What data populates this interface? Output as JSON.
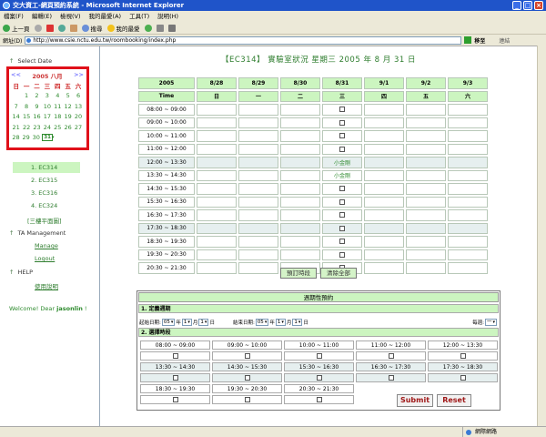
{
  "window": {
    "title": "交大資工-網頁預約系統 - Microsoft Internet Explorer"
  },
  "menu": [
    "檔案(F)",
    "編輯(E)",
    "檢視(V)",
    "我的最愛(A)",
    "工具(T)",
    "說明(H)"
  ],
  "toolbar": {
    "back": "上一頁",
    "search": "搜尋",
    "favorites": "我的最愛"
  },
  "address": {
    "label": "網址(D)",
    "url": "http://www.csie.nctu.edu.tw/roombooking/index.php",
    "go": "移至",
    "links": "連結"
  },
  "sidebar": {
    "select_date": "Select Date",
    "calendar": {
      "month_label": "2005 八月",
      "prev": "<<",
      "next": ">>",
      "weekdays": [
        "日",
        "一",
        "二",
        "三",
        "四",
        "五",
        "六"
      ],
      "weeks": [
        [
          "",
          "1",
          "2",
          "3",
          "4",
          "5",
          "6"
        ],
        [
          "7",
          "8",
          "9",
          "10",
          "11",
          "12",
          "13"
        ],
        [
          "14",
          "15",
          "16",
          "17",
          "18",
          "19",
          "20"
        ],
        [
          "21",
          "22",
          "23",
          "24",
          "25",
          "26",
          "27"
        ],
        [
          "28",
          "29",
          "30",
          "31",
          "",
          "",
          ""
        ]
      ],
      "selected": "31"
    },
    "rooms": [
      "1. EC314",
      "2. EC315",
      "3. EC316",
      "4. EC324"
    ],
    "floor_link": "[三樓平面圖]",
    "ta_title": "TA Management",
    "manage": "Manage",
    "logout": "Logout",
    "help_title": "HELP",
    "help_link": "使用說明",
    "welcome": "Welcome! Dear",
    "user": "jasonlin"
  },
  "main": {
    "heading": "【EC314】 實驗室狀況 星期三 2005 年 8 月 31 日",
    "header_dates": [
      "2005",
      "8/28",
      "8/29",
      "8/30",
      "8/31",
      "9/1",
      "9/2",
      "9/3"
    ],
    "header_days": [
      "Time",
      "日",
      "一",
      "二",
      "三",
      "四",
      "五",
      "六"
    ],
    "slots": [
      {
        "time": "08:00 ~ 09:00",
        "cells": [
          "",
          "",
          "",
          "cb",
          "",
          "",
          ""
        ]
      },
      {
        "time": "09:00 ~ 10:00",
        "cells": [
          "",
          "",
          "",
          "cb",
          "",
          "",
          ""
        ]
      },
      {
        "time": "10:00 ~ 11:00",
        "cells": [
          "",
          "",
          "",
          "cb",
          "",
          "",
          ""
        ]
      },
      {
        "time": "11:00 ~ 12:00",
        "cells": [
          "",
          "",
          "",
          "cb",
          "",
          "",
          ""
        ]
      },
      {
        "time": "12:00 ~ 13:30",
        "cells": [
          "",
          "",
          "",
          "小金剛",
          "",
          "",
          ""
        ]
      },
      {
        "time": "13:30 ~ 14:30",
        "cells": [
          "",
          "",
          "",
          "小金剛",
          "",
          "",
          ""
        ]
      },
      {
        "time": "14:30 ~ 15:30",
        "cells": [
          "",
          "",
          "",
          "cb",
          "",
          "",
          ""
        ]
      },
      {
        "time": "15:30 ~ 16:30",
        "cells": [
          "",
          "",
          "",
          "cb",
          "",
          "",
          ""
        ]
      },
      {
        "time": "16:30 ~ 17:30",
        "cells": [
          "",
          "",
          "",
          "cb",
          "",
          "",
          ""
        ]
      },
      {
        "time": "17:30 ~ 18:30",
        "cells": [
          "",
          "",
          "",
          "cb",
          "",
          "",
          ""
        ]
      },
      {
        "time": "18:30 ~ 19:30",
        "cells": [
          "",
          "",
          "",
          "cb",
          "",
          "",
          ""
        ]
      },
      {
        "time": "19:30 ~ 20:30",
        "cells": [
          "",
          "",
          "",
          "cb",
          "",
          "",
          ""
        ]
      },
      {
        "time": "20:30 ~ 21:30",
        "cells": [
          "",
          "",
          "",
          "cb",
          "",
          "",
          ""
        ]
      }
    ],
    "reserve_btn": "預訂時段",
    "clear_btn": "清除全部"
  },
  "periodic": {
    "title": "週期性預約",
    "sec1": "1. 定義週期",
    "start_label": "起始日期:",
    "start": {
      "y": "05",
      "m": "1",
      "d": "1"
    },
    "end_label": "結束日期:",
    "end": {
      "y": "05",
      "m": "1",
      "d": "1"
    },
    "year_unit": "年",
    "month_unit": "月",
    "day_unit": "日",
    "week_label": "每週:",
    "week_value": "一",
    "sec2": "2. 選擇時段",
    "slots": [
      [
        "08:00 ~ 09:00",
        "09:00 ~ 10:00",
        "10:00 ~ 11:00",
        "11:00 ~ 12:00",
        "12:00 ~ 13:30"
      ],
      [
        "13:30 ~ 14:30",
        "14:30 ~ 15:30",
        "15:30 ~ 16:30",
        "16:30 ~ 17:30",
        "17:30 ~ 18:30"
      ],
      [
        "18:30 ~ 19:30",
        "19:30 ~ 20:30",
        "20:30 ~ 21:30"
      ]
    ],
    "submit": "Submit",
    "reset": "Reset"
  },
  "status": {
    "zone": "網際網路"
  }
}
